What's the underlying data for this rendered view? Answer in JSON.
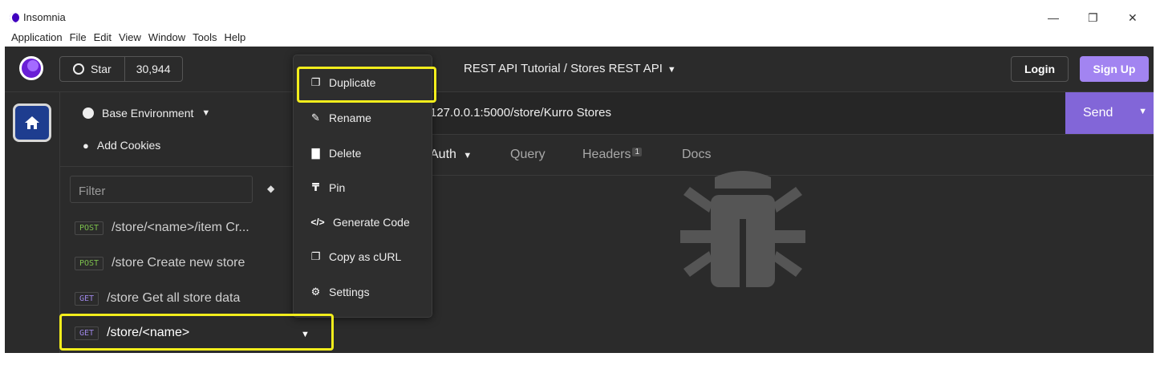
{
  "window": {
    "title": "Insomnia",
    "controls": [
      "—",
      "❐",
      "✕"
    ]
  },
  "menubar": [
    "Application",
    "File",
    "Edit",
    "View",
    "Window",
    "Tools",
    "Help"
  ],
  "topbar": {
    "star_label": "Star",
    "star_count": "30,944",
    "project": "REST API Tutorial",
    "separator": "/",
    "collection": "Stores REST API",
    "login": "Login",
    "signup": "Sign Up"
  },
  "sidebar": {
    "environment": "Base Environment",
    "cookies": "Add Cookies",
    "filter_placeholder": "Filter",
    "requests": [
      {
        "method": "POST",
        "label": "/store/<name>/item Cr..."
      },
      {
        "method": "POST",
        "label": "/store Create new store"
      },
      {
        "method": "GET",
        "label": "/store Get all store data"
      },
      {
        "method": "GET",
        "label": "/store/<name>"
      }
    ]
  },
  "request": {
    "url": "127.0.0.1:5000/store/Kurro Stores",
    "send": "Send",
    "tabs": [
      {
        "label": "Auth"
      },
      {
        "label": "Query"
      },
      {
        "label": "Headers",
        "badge": "1"
      },
      {
        "label": "Docs"
      }
    ]
  },
  "context_menu": {
    "items": [
      {
        "icon": "duplicate-icon",
        "label": "Duplicate"
      },
      {
        "icon": "pencil-icon",
        "label": "Rename"
      },
      {
        "icon": "trash-icon",
        "label": "Delete"
      },
      {
        "icon": "pin-icon",
        "label": "Pin"
      },
      {
        "icon": "code-icon",
        "label": "Generate Code"
      },
      {
        "icon": "copy-icon",
        "label": "Copy as cURL"
      },
      {
        "icon": "gear-icon",
        "label": "Settings"
      }
    ]
  },
  "colors": {
    "accent": "#8266d8",
    "signup": "#a284f1",
    "highlight": "#f2ed1c",
    "post": "#7cc04d",
    "get": "#9d86e6"
  }
}
